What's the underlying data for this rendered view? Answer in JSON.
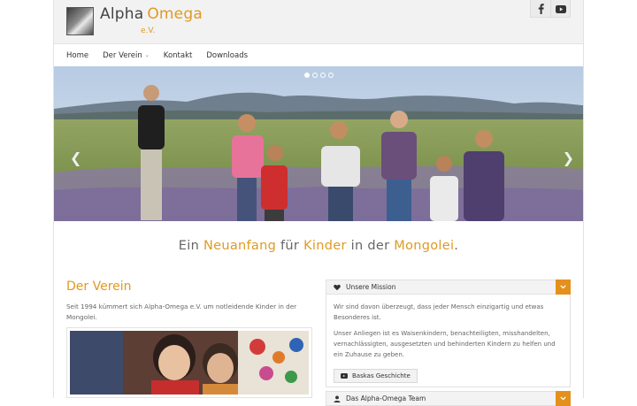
{
  "header": {
    "brand_part1": "Alpha",
    "brand_part2": "Omega",
    "brand_sub": "e.V.",
    "social": [
      {
        "icon": "facebook-icon"
      },
      {
        "icon": "youtube-icon"
      }
    ]
  },
  "nav": {
    "items": [
      {
        "label": "Home"
      },
      {
        "label": "Der Verein",
        "has_dropdown": true
      },
      {
        "label": "Kontakt"
      },
      {
        "label": "Downloads"
      }
    ]
  },
  "slider": {
    "slide_count": 4,
    "active_slide": 1,
    "prev_icon": "chevron-left-icon",
    "next_icon": "chevron-right-icon"
  },
  "tagline": {
    "t1": "Ein ",
    "t2": "Neuanfang",
    "t3": " für ",
    "t4": "Kinder",
    "t5": " in der ",
    "t6": "Mongolei",
    "t7": "."
  },
  "verein": {
    "title": "Der Verein",
    "text": "Seit 1994 kümmert sich Alpha-Omega e.V. um notleidende Kinder in der Mongolei."
  },
  "accordion": {
    "panel1": {
      "title": "Unsere Mission",
      "p1": "Wir sind davon überzeugt, dass jeder Mensch einzigartig und etwas Besonderes ist.",
      "p2": "Unser Anliegen ist es Waisenkindern, benachteiligten, misshandelten, vernachlässigten, ausgesetzten und behinderten Kindern zu helfen und ein Zuhause zu geben.",
      "button": "Baskas Geschichte"
    },
    "panel2": {
      "title": "Das Alpha-Omega Team"
    }
  },
  "colors": {
    "accent": "#e09a22",
    "toggle": "#e4901d"
  }
}
